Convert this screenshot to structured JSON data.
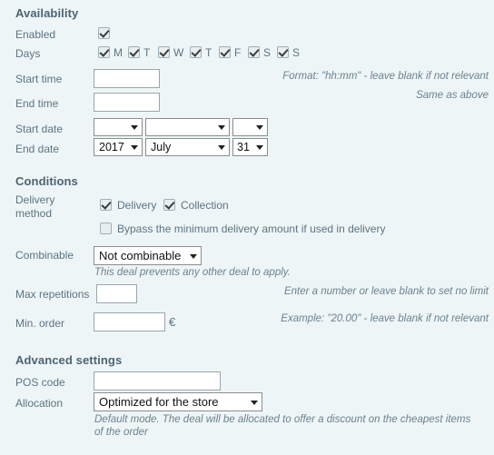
{
  "sections": {
    "availability": {
      "title": "Availability",
      "enabled": {
        "label": "Enabled",
        "checked": true
      },
      "days": {
        "label": "Days",
        "items": [
          {
            "letter": "M",
            "checked": true
          },
          {
            "letter": "T",
            "checked": true
          },
          {
            "letter": "W",
            "checked": true
          },
          {
            "letter": "T",
            "checked": true
          },
          {
            "letter": "F",
            "checked": true
          },
          {
            "letter": "S",
            "checked": true
          },
          {
            "letter": "S",
            "checked": true
          }
        ]
      },
      "start_time": {
        "label": "Start time",
        "value": "",
        "hint": "Format: \"hh:mm\" - leave blank if not relevant"
      },
      "end_time": {
        "label": "End time",
        "value": "",
        "hint": "Same as above"
      },
      "start_date": {
        "label": "Start date",
        "year": "",
        "month": "",
        "day": ""
      },
      "end_date": {
        "label": "End date",
        "year": "2017",
        "month": "July",
        "day": "31"
      }
    },
    "conditions": {
      "title": "Conditions",
      "delivery_method": {
        "label": "Delivery method",
        "delivery": {
          "label": "Delivery",
          "checked": true
        },
        "collection": {
          "label": "Collection",
          "checked": true
        },
        "bypass": {
          "label": "Bypass the minimum delivery amount if used in delivery",
          "checked": false
        }
      },
      "combinable": {
        "label": "Combinable",
        "value": "Not combinable",
        "hint": "This deal prevents any other deal to apply."
      },
      "max_repetitions": {
        "label": "Max repetitions",
        "value": "",
        "hint": "Enter a number or leave blank to set no limit"
      },
      "min_order": {
        "label": "Min. order",
        "value": "",
        "currency": "€",
        "hint": "Example: \"20.00\" - leave blank if not relevant"
      }
    },
    "advanced": {
      "title": "Advanced settings",
      "pos_code": {
        "label": "POS code",
        "value": ""
      },
      "allocation": {
        "label": "Allocation",
        "value": "Optimized for the store",
        "hint": "Default mode. The deal will be allocated to offer a discount on the cheapest items of the order"
      }
    }
  },
  "colors": {
    "background": "#eef5f7",
    "heading": "#4c6472",
    "label": "#5b7480",
    "hint": "#6a828c"
  }
}
